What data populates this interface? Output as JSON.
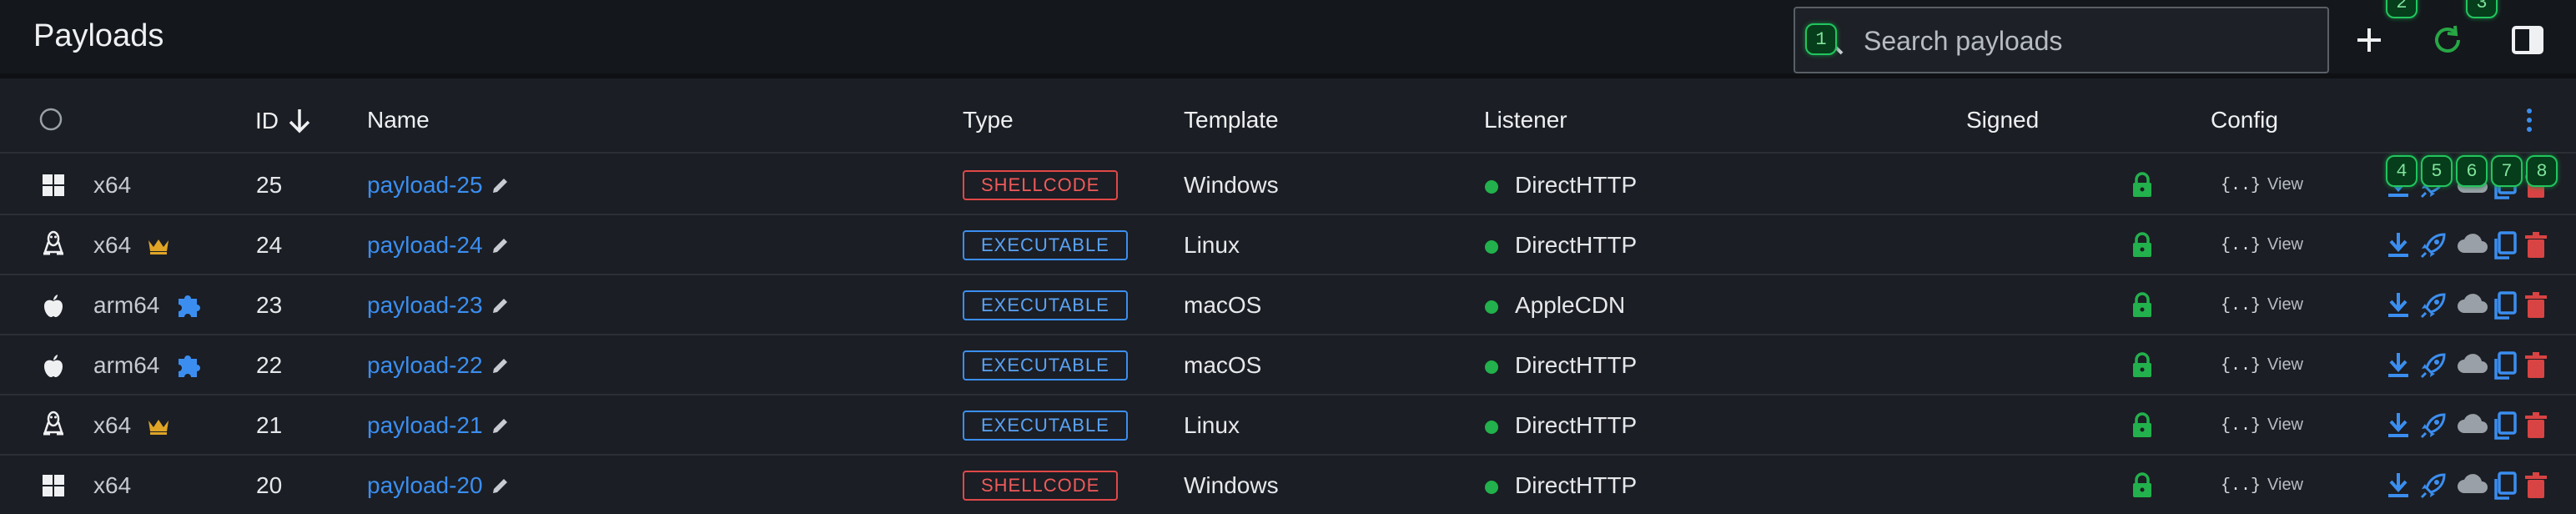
{
  "header": {
    "title": "Payloads",
    "search_placeholder": "Search payloads",
    "hints": [
      "1",
      "2",
      "3"
    ]
  },
  "table": {
    "columns": [
      "ID",
      "Name",
      "Type",
      "Template",
      "Listener",
      "Signed",
      "Config"
    ],
    "sort": {
      "column": "ID",
      "direction": "descending"
    },
    "action_hints": [
      "4",
      "5",
      "6",
      "7",
      "8"
    ],
    "rows": [
      {
        "os": "windows-icon",
        "arch": "x64",
        "badge": "",
        "id": "25",
        "name": "payload-25",
        "type": "SHELLCODE",
        "template": "Windows",
        "listener": "DirectHTTP",
        "config_label": "View",
        "config_glyph": "{..}"
      },
      {
        "os": "linux-icon",
        "arch": "x64",
        "badge": "crown-icon",
        "id": "24",
        "name": "payload-24",
        "type": "EXECUTABLE",
        "template": "Linux",
        "listener": "DirectHTTP",
        "config_label": "View",
        "config_glyph": "{..}"
      },
      {
        "os": "apple-icon",
        "arch": "arm64",
        "badge": "puzzle-icon",
        "id": "23",
        "name": "payload-23",
        "type": "EXECUTABLE",
        "template": "macOS",
        "listener": "AppleCDN",
        "config_label": "View",
        "config_glyph": "{..}"
      },
      {
        "os": "apple-icon",
        "arch": "arm64",
        "badge": "puzzle-icon",
        "id": "22",
        "name": "payload-22",
        "type": "EXECUTABLE",
        "template": "macOS",
        "listener": "DirectHTTP",
        "config_label": "View",
        "config_glyph": "{..}"
      },
      {
        "os": "linux-icon",
        "arch": "x64",
        "badge": "crown-icon",
        "id": "21",
        "name": "payload-21",
        "type": "EXECUTABLE",
        "template": "Linux",
        "listener": "DirectHTTP",
        "config_label": "View",
        "config_glyph": "{..}"
      },
      {
        "os": "windows-icon",
        "arch": "x64",
        "badge": "",
        "id": "20",
        "name": "payload-20",
        "type": "SHELLCODE",
        "template": "Windows",
        "listener": "DirectHTTP",
        "config_label": "View",
        "config_glyph": "{..}"
      }
    ]
  },
  "colors": {
    "accent": "#3b8ef0",
    "shellcode": "#e04848",
    "executable": "#3b8ef0",
    "listener_online": "#22b14c",
    "signed": "#22b14c",
    "crown": "#e0a526",
    "delete": "#d84343",
    "cloud": "#9aa0a8"
  }
}
